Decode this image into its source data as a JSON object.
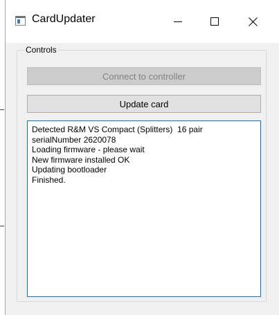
{
  "window": {
    "title": "CardUpdater",
    "icons": {
      "app": "app-window-icon",
      "minimize": "minimize-icon",
      "maximize": "maximize-icon",
      "close": "close-icon"
    }
  },
  "controls": {
    "group_title": "Controls",
    "connect_label": "Connect to controller",
    "connect_enabled": false,
    "update_label": "Update card",
    "log_lines": [
      "Detected R&M VS Compact (Splitters)  16 pair",
      "serialNumber 2620078",
      "Loading firmware - please wait",
      "New firmware installed OK",
      "Updating bootloader",
      "Finished."
    ]
  },
  "colors": {
    "focus_border": "#0078d7",
    "window_bg": "#f0f0f0",
    "disabled_text": "#838383"
  }
}
